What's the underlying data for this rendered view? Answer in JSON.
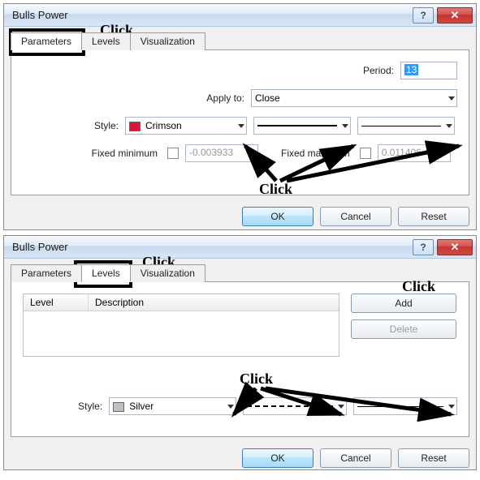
{
  "dialog1": {
    "title": "Bulls Power",
    "tabs": [
      "Parameters",
      "Levels",
      "Visualization"
    ],
    "active_tab": 0,
    "period_label": "Period:",
    "period_value": "13",
    "apply_label": "Apply to:",
    "apply_value": "Close",
    "style_label": "Style:",
    "style_color_name": "Crimson",
    "fixed_min_label": "Fixed minimum",
    "fixed_min_value": "-0.003933",
    "fixed_max_label": "Fixed maximum",
    "fixed_max_value": "0.011406",
    "ok": "OK",
    "cancel": "Cancel",
    "reset": "Reset"
  },
  "dialog2": {
    "title": "Bulls Power",
    "tabs": [
      "Parameters",
      "Levels",
      "Visualization"
    ],
    "active_tab": 1,
    "col_level": "Level",
    "col_desc": "Description",
    "add": "Add",
    "delete": "Delete",
    "style_label": "Style:",
    "style_color_name": "Silver",
    "ok": "OK",
    "cancel": "Cancel",
    "reset": "Reset"
  },
  "annotations": {
    "click": "Click"
  }
}
